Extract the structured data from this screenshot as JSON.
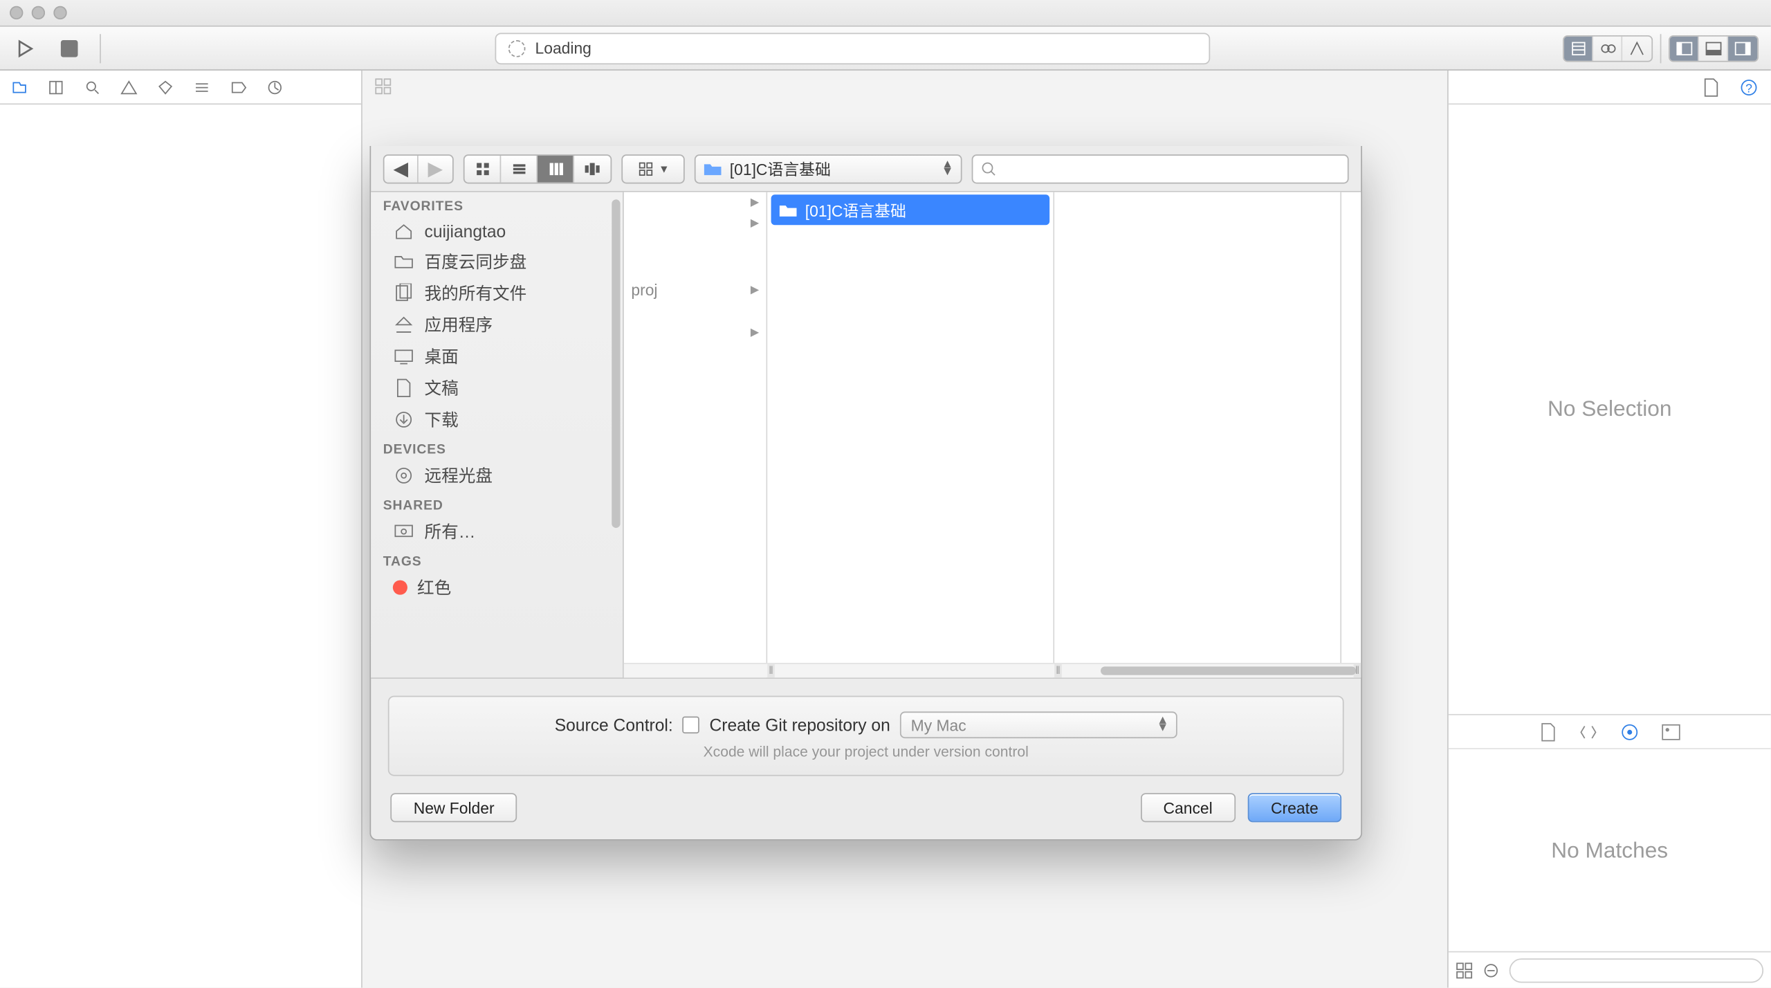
{
  "titlebar": {},
  "toolbar": {
    "loading_text": "Loading"
  },
  "sheet": {
    "location": "[01]C语言基础",
    "sidebar": {
      "sections": {
        "favorites": "FAVORITES",
        "devices": "DEVICES",
        "shared": "SHARED",
        "tags": "TAGS"
      },
      "favorites": [
        {
          "label": "cuijiangtao",
          "icon": "home"
        },
        {
          "label": "百度云同步盘",
          "icon": "folder"
        },
        {
          "label": "我的所有文件",
          "icon": "all-files"
        },
        {
          "label": "应用程序",
          "icon": "applications"
        },
        {
          "label": "桌面",
          "icon": "desktop"
        },
        {
          "label": "文稿",
          "icon": "documents"
        },
        {
          "label": "下载",
          "icon": "downloads"
        }
      ],
      "devices": [
        {
          "label": "远程光盘",
          "icon": "remote-disc"
        }
      ],
      "shared": [
        {
          "label": "所有…",
          "icon": "network"
        }
      ],
      "tags": [
        {
          "label": "红色",
          "color": "#ff5b4d"
        }
      ]
    },
    "columns": {
      "col1_items": [
        "",
        "",
        "proj",
        ""
      ],
      "selected_folder": "[01]C语言基础"
    },
    "source_control": {
      "label": "Source Control:",
      "checkbox_label": "Create Git repository on",
      "location": "My Mac",
      "subtext": "Xcode will place your project under version control"
    },
    "buttons": {
      "new_folder": "New Folder",
      "cancel": "Cancel",
      "create": "Create"
    }
  },
  "right_panel": {
    "no_selection": "No Selection",
    "no_matches": "No Matches"
  }
}
